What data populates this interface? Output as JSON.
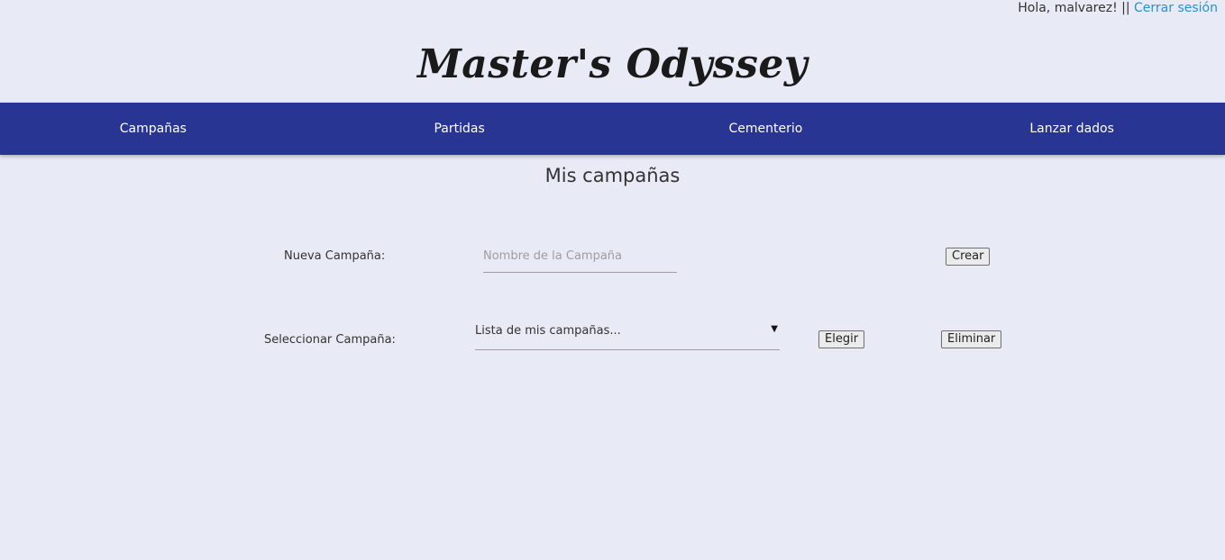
{
  "user_bar": {
    "greeting": "Hola, malvarez! || ",
    "logout_label": "Cerrar sesión"
  },
  "brand": {
    "title": "Master's Odyssey"
  },
  "nav": {
    "items": [
      {
        "label": "Campañas"
      },
      {
        "label": "Partidas"
      },
      {
        "label": "Cementerio"
      },
      {
        "label": "Lanzar dados"
      }
    ]
  },
  "main": {
    "title": "Mis campañas",
    "new_campaign": {
      "label": "Nueva Campaña:",
      "input_placeholder": "Nombre de la Campaña",
      "input_value": "",
      "create_label": "Crear"
    },
    "select_campaign": {
      "label": "Seleccionar Campaña:",
      "selected_value": "Lista de mis campañas...",
      "caret": "▼",
      "choose_label": "Elegir",
      "delete_label": "Eliminar"
    }
  },
  "colors": {
    "background": "#e8eaf6",
    "navbar": "#283593",
    "link": "#2a8fd6"
  }
}
